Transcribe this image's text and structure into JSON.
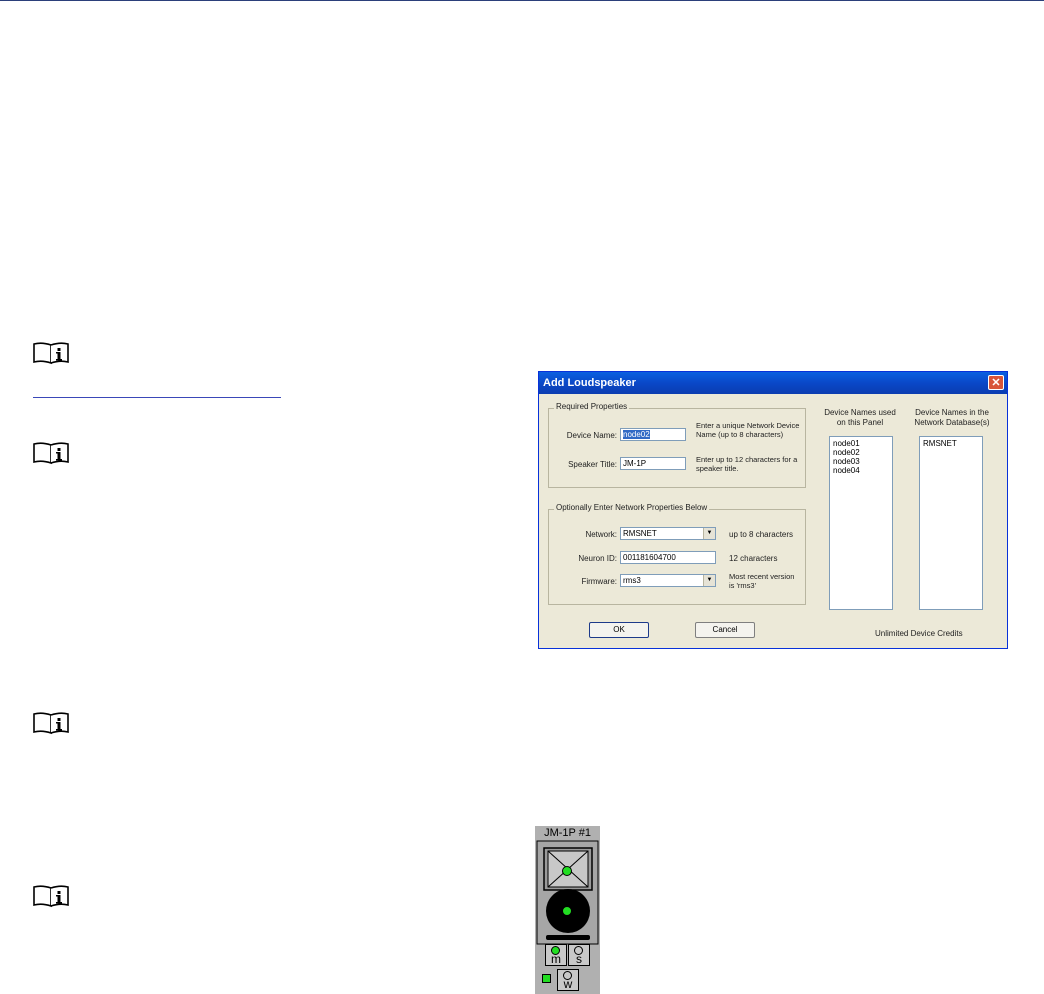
{
  "page": {
    "icons": [
      "info-manual-icon",
      "info-manual-icon",
      "info-manual-icon",
      "info-manual-icon"
    ]
  },
  "dialog": {
    "title": "Add Loudspeaker",
    "close_glyph": "✕",
    "required": {
      "title": "Required Properties",
      "device_name_label": "Device Name:",
      "device_name_value": "node02",
      "device_name_hint": "Enter  a unique Network Device  Name (up to 8 characters)",
      "speaker_title_label": "Speaker Title:",
      "speaker_title_value": "JM-1P",
      "speaker_title_hint": "Enter up to 12 characters for a speaker title."
    },
    "optional": {
      "title": "Optionally Enter Network Properties Below",
      "network_label": "Network:",
      "network_value": "RMSNET",
      "network_hint": "up to 8 characters",
      "neuron_label": "Neuron ID:",
      "neuron_value": "001181604700",
      "neuron_hint": "12 characters",
      "firmware_label": "Firmware:",
      "firmware_value": "rms3",
      "firmware_hint": "Most recent version is 'rms3'"
    },
    "panel_list": {
      "header": "Device Names used on this Panel",
      "items": [
        "node01",
        "node02",
        "node03",
        "node04"
      ]
    },
    "db_list": {
      "header": "Device Names in the Network Database(s)",
      "items": [
        "RMSNET"
      ]
    },
    "ok_label": "OK",
    "cancel_label": "Cancel",
    "credits": "Unlimited Device Credits"
  },
  "speaker_widget": {
    "title": "JM-1P #1",
    "button_m": "m",
    "button_s": "s",
    "button_w": "w",
    "status_color": "#22dd22"
  }
}
